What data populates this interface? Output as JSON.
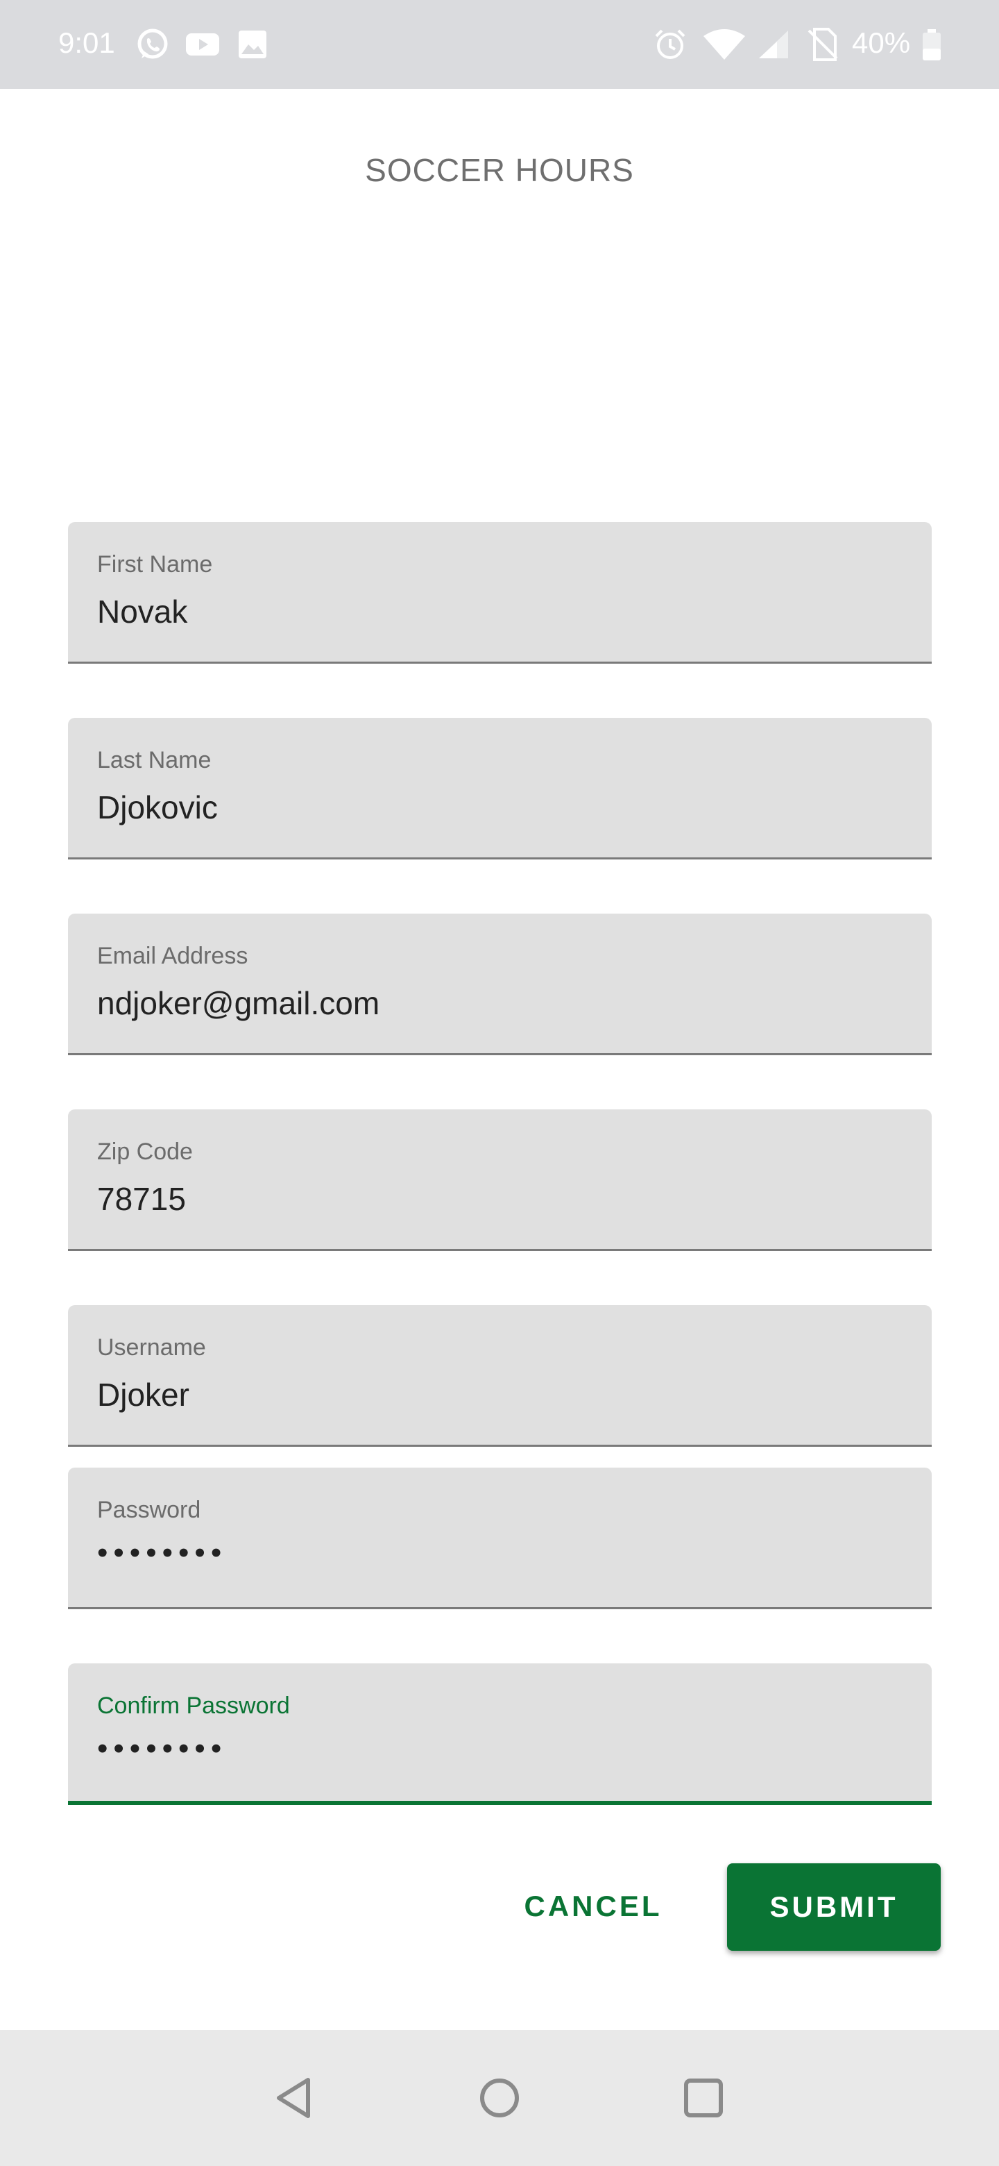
{
  "status_bar": {
    "time": "9:01",
    "battery": "40%",
    "left_icons": [
      "whatsapp-icon",
      "youtube-icon",
      "gallery-icon"
    ],
    "right_icons": [
      "alarm-icon",
      "wifi-icon",
      "signal-icon",
      "no-sim-icon",
      "battery-icon"
    ]
  },
  "app": {
    "title": "SOCCER HOURS"
  },
  "form": {
    "first_name": {
      "label": "First Name",
      "value": "Novak"
    },
    "last_name": {
      "label": "Last Name",
      "value": "Djokovic"
    },
    "email": {
      "label": "Email Address",
      "value": "ndjoker@gmail.com"
    },
    "zip": {
      "label": "Zip Code",
      "value": "78715"
    },
    "username": {
      "label": "Username",
      "value": "Djoker"
    },
    "password": {
      "label": "Password",
      "value": "••••••••"
    },
    "confirm_password": {
      "label": "Confirm Password",
      "value": "••••••••"
    }
  },
  "actions": {
    "cancel_label": "CANCEL",
    "submit_label": "SUBMIT"
  },
  "colors": {
    "accent": "#0a7434",
    "field_bg": "#e0e0e0",
    "status_bar_bg": "#dadbde"
  },
  "nav_bar": {
    "icons": [
      "back-icon",
      "home-icon",
      "recents-icon"
    ]
  }
}
